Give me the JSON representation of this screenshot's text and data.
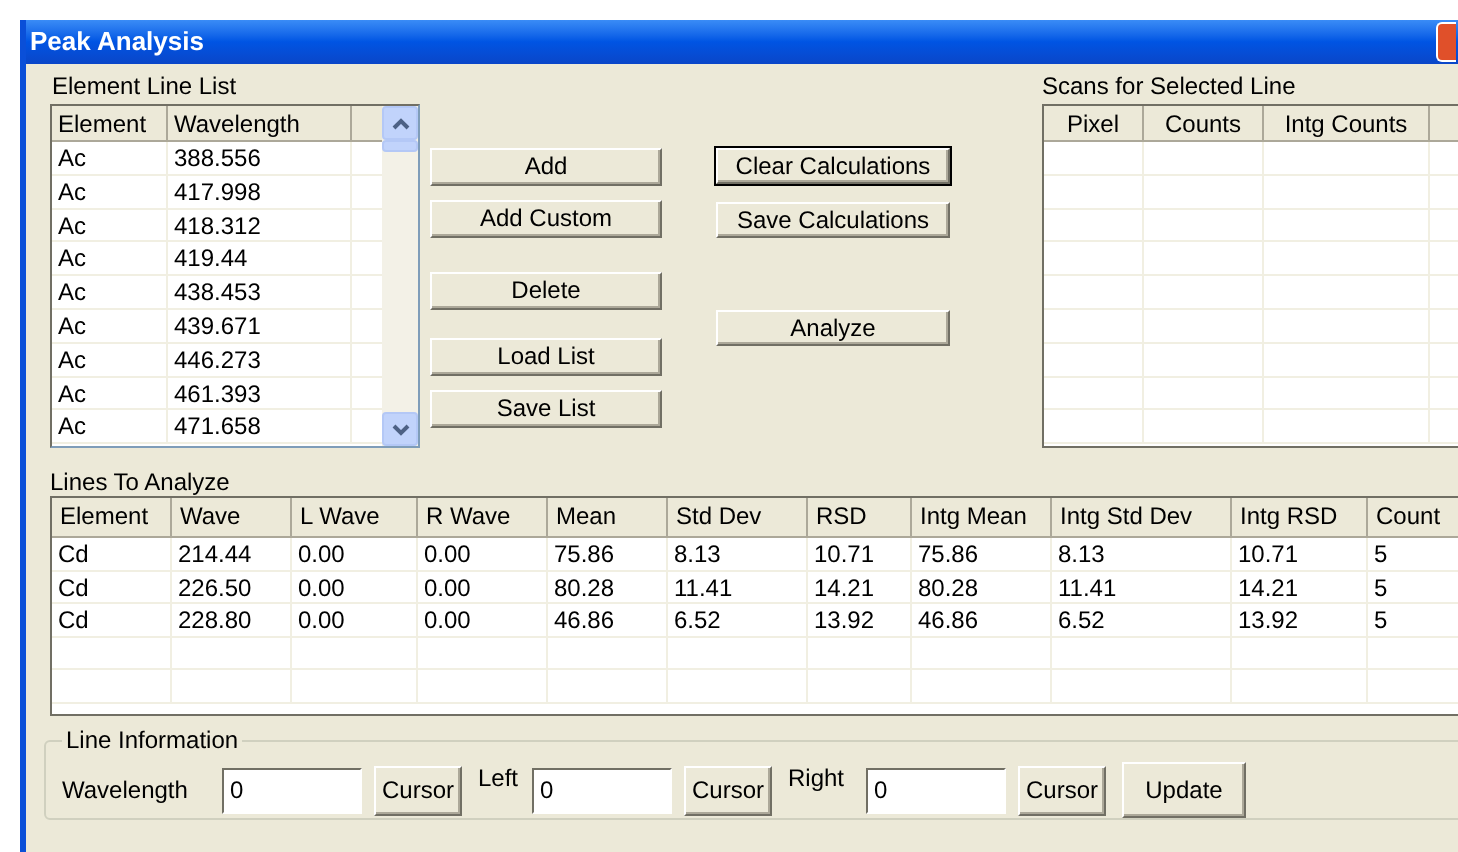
{
  "window": {
    "title": "Peak Analysis"
  },
  "element_line_list": {
    "label": "Element Line List",
    "columns": [
      "Element",
      "Wavelength"
    ],
    "rows": [
      [
        "Ac",
        "388.556"
      ],
      [
        "Ac",
        "417.998"
      ],
      [
        "Ac",
        "418.312"
      ],
      [
        "Ac",
        "419.44"
      ],
      [
        "Ac",
        "438.453"
      ],
      [
        "Ac",
        "439.671"
      ],
      [
        "Ac",
        "446.273"
      ],
      [
        "Ac",
        "461.393"
      ],
      [
        "Ac",
        "471.658"
      ]
    ]
  },
  "list_buttons": [
    "Add",
    "Add Custom",
    "Delete",
    "Load List",
    "Save List"
  ],
  "calc_buttons": [
    {
      "label": "Clear Calculations",
      "selected": true
    },
    {
      "label": "Save Calculations",
      "selected": false
    },
    {
      "label": "Analyze",
      "selected": false
    }
  ],
  "scans": {
    "label": "Scans for Selected Line",
    "columns": [
      "Pixel",
      "Counts",
      "Intg Counts"
    ]
  },
  "lines_to_analyze": {
    "label": "Lines To Analyze",
    "columns": [
      "Element",
      "Wave",
      "L Wave",
      "R Wave",
      "Mean",
      "Std Dev",
      "RSD",
      "Intg Mean",
      "Intg Std Dev",
      "Intg RSD",
      "Count"
    ],
    "rows": [
      [
        "Cd",
        "214.44",
        "0.00",
        "0.00",
        "75.86",
        "8.13",
        "10.71",
        "75.86",
        "8.13",
        "10.71",
        "5"
      ],
      [
        "Cd",
        "226.50",
        "0.00",
        "0.00",
        "80.28",
        "11.41",
        "14.21",
        "80.28",
        "11.41",
        "14.21",
        "5"
      ],
      [
        "Cd",
        "228.80",
        "0.00",
        "0.00",
        "46.86",
        "6.52",
        "13.92",
        "46.86",
        "6.52",
        "13.92",
        "5"
      ]
    ]
  },
  "line_information": {
    "label": "Line Information",
    "fields": [
      {
        "label": "Wavelength",
        "value": "0",
        "button": "Cursor"
      },
      {
        "label": "Left",
        "value": "0",
        "button": "Cursor"
      },
      {
        "label": "Right",
        "value": "0",
        "button": "Cursor"
      }
    ],
    "update_button": "Update"
  }
}
